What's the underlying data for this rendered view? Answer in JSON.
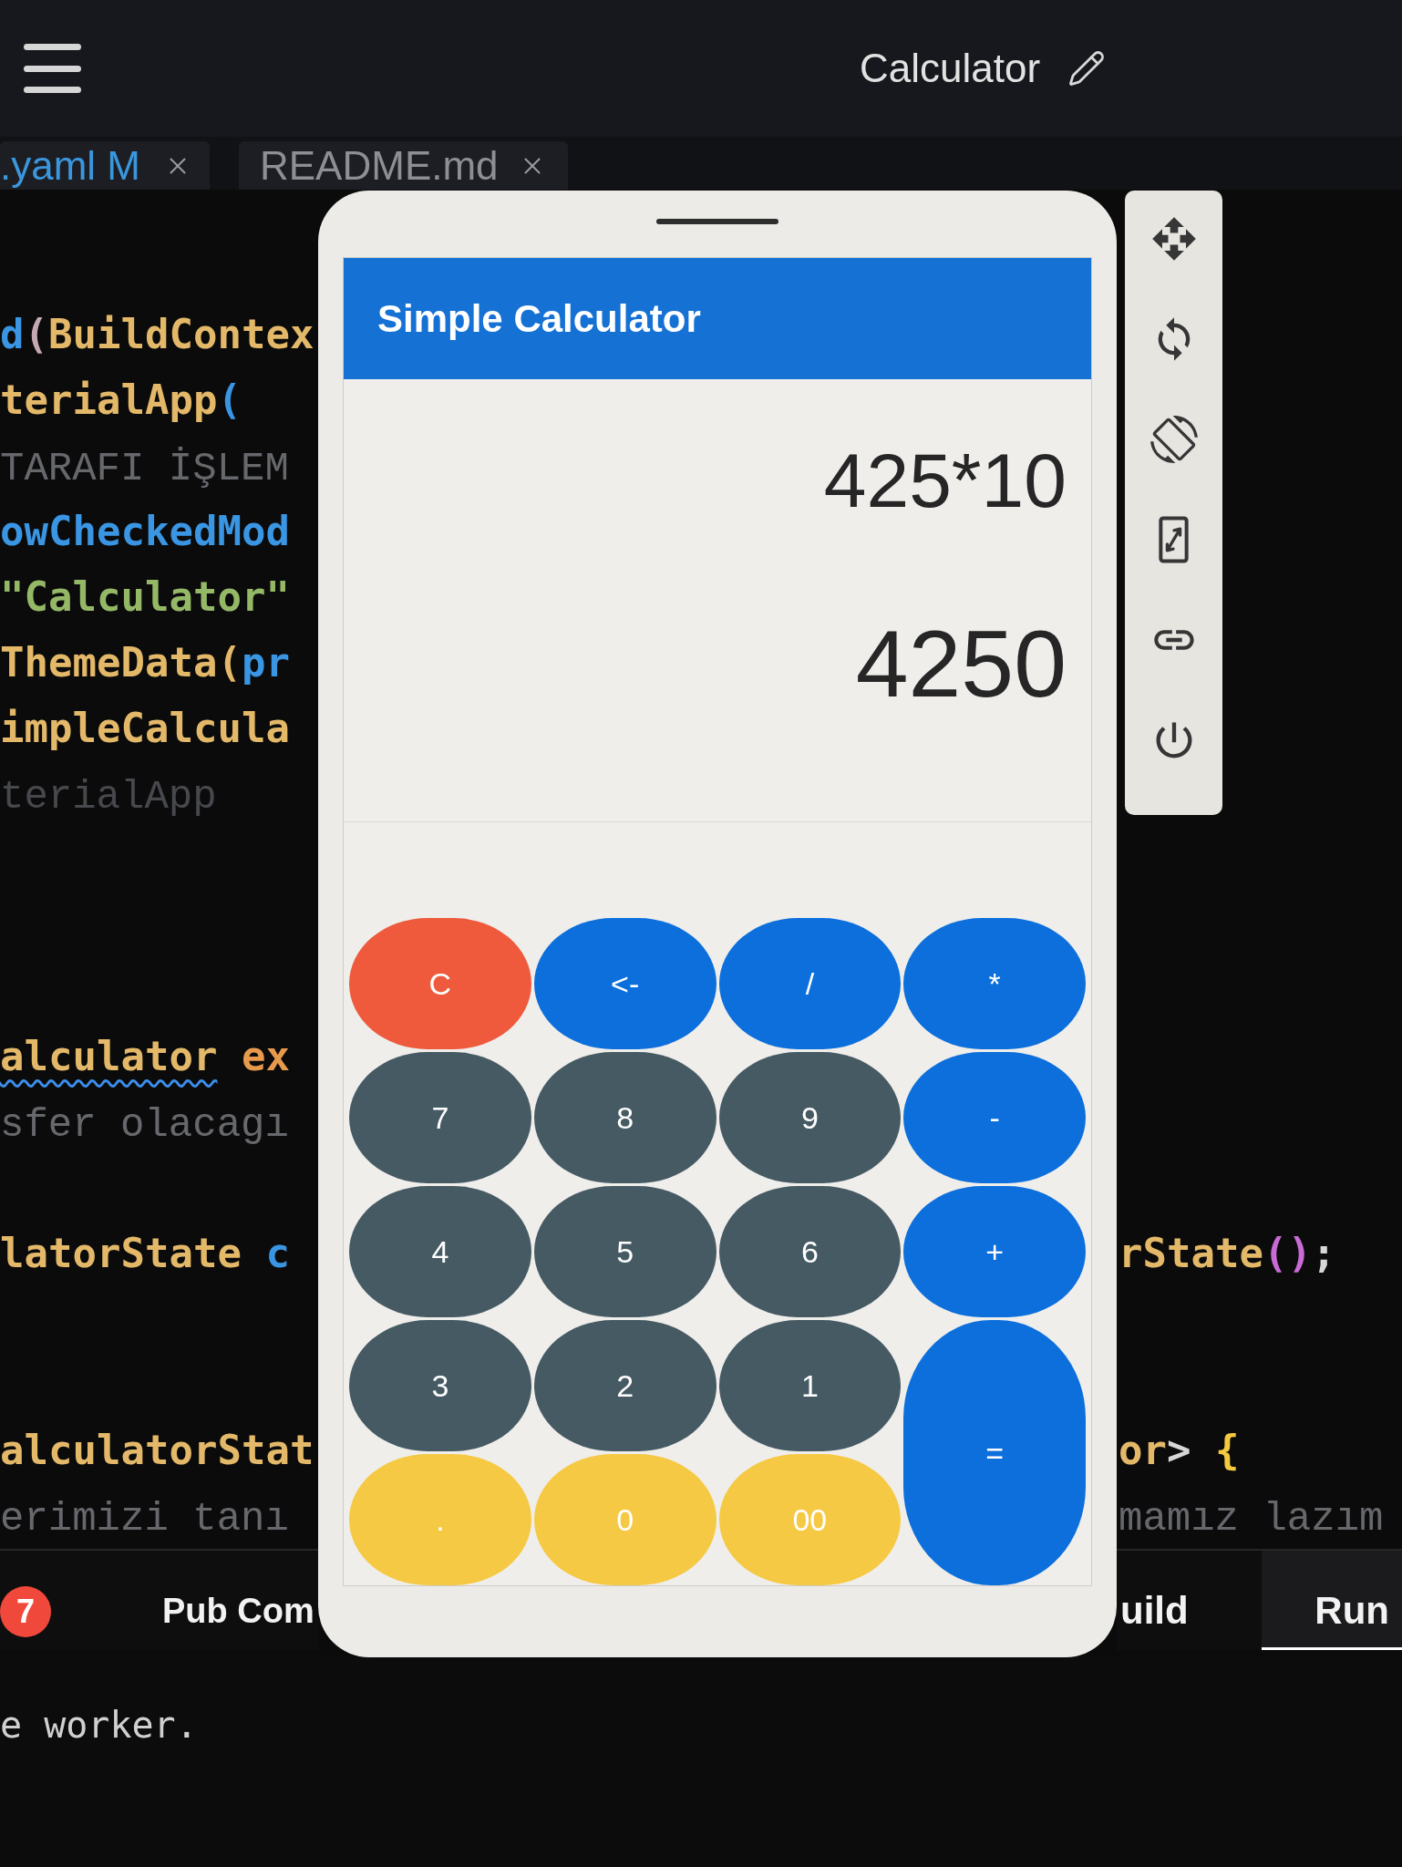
{
  "top_bar": {
    "title": "Calculator"
  },
  "editor_tabs": [
    {
      "label": ".yaml M",
      "modified": true
    },
    {
      "label": "README.md",
      "modified": false
    }
  ],
  "editor": {
    "lines": [
      {
        "kind": "code",
        "left": [
          {
            "text": "d",
            "kind": "keyword",
            "warning": false
          },
          {
            "text": "(",
            "kind": "operator",
            "warning": false
          },
          {
            "text": "BuildContex",
            "kind": "class",
            "warning": false
          }
        ]
      },
      {
        "kind": "code",
        "left": [
          {
            "text": "terialApp",
            "kind": "class",
            "warning": false
          },
          {
            "text": "(",
            "kind": "keyword",
            "warning": false
          }
        ]
      },
      {
        "kind": "code",
        "left": [
          {
            "text": "TARAFI İŞLEM",
            "kind": "comment",
            "warning": false
          }
        ]
      },
      {
        "kind": "code",
        "left": [
          {
            "text": "owCheckedMod",
            "kind": "keyword",
            "warning": false
          }
        ]
      },
      {
        "kind": "code",
        "left": [
          {
            "text": "\"Calculator\"",
            "kind": "string",
            "warning": false
          }
        ]
      },
      {
        "kind": "code",
        "left": [
          {
            "text": "ThemeData(",
            "kind": "class",
            "warning": false
          },
          {
            "text": "pr",
            "kind": "keyword",
            "warning": false
          }
        ]
      },
      {
        "kind": "code",
        "left": [
          {
            "text": "impleCalcula",
            "kind": "class",
            "warning": false
          }
        ]
      },
      {
        "kind": "code",
        "left": [
          {
            "text": "terialApp",
            "kind": "label",
            "warning": false
          }
        ]
      },
      {
        "kind": "blank"
      },
      {
        "kind": "blank"
      },
      {
        "kind": "blank"
      },
      {
        "kind": "code",
        "left": [
          {
            "text": "alculator",
            "kind": "class",
            "warning": true
          },
          {
            "text": " ex",
            "kind": "modifier",
            "warning": false
          }
        ]
      },
      {
        "kind": "code",
        "left": [
          {
            "text": "sfer olacagı",
            "kind": "comment",
            "warning": false
          }
        ]
      },
      {
        "kind": "blank"
      },
      {
        "kind": "code",
        "left": [
          {
            "text": "latorState",
            "kind": "class",
            "warning": false
          },
          {
            "text": " c",
            "kind": "keyword",
            "warning": false
          }
        ],
        "right": [
          {
            "text": "rState",
            "kind": "class",
            "warning": false
          },
          {
            "text": "()",
            "kind": "paren",
            "warning": false
          },
          {
            "text": ";",
            "kind": "plain",
            "warning": false
          }
        ]
      },
      {
        "kind": "blank"
      },
      {
        "kind": "blank"
      },
      {
        "kind": "code",
        "left": [
          {
            "text": "alculatorStat",
            "kind": "class",
            "warning": false
          }
        ],
        "right": [
          {
            "text": "or",
            "kind": "class",
            "warning": false
          },
          {
            "text": ">",
            "kind": "plain",
            "warning": false
          },
          {
            "text": " {",
            "kind": "brace",
            "warning": false
          }
        ]
      },
      {
        "kind": "code",
        "left": [
          {
            "text": "erimizi tanı",
            "kind": "comment",
            "warning": false
          }
        ],
        "right": [
          {
            "text": "mamız lazım",
            "kind": "comment",
            "warning": false
          }
        ]
      }
    ]
  },
  "emulator": {
    "app_title": "Simple Calculator",
    "expression": "425*10",
    "result": "4250",
    "keys": [
      {
        "label": "C",
        "kind": "clear"
      },
      {
        "label": "<-",
        "kind": "operator"
      },
      {
        "label": "/",
        "kind": "operator"
      },
      {
        "label": "*",
        "kind": "operator"
      },
      {
        "label": "7",
        "kind": "digit"
      },
      {
        "label": "8",
        "kind": "digit"
      },
      {
        "label": "9",
        "kind": "digit"
      },
      {
        "label": "-",
        "kind": "operator"
      },
      {
        "label": "4",
        "kind": "digit"
      },
      {
        "label": "5",
        "kind": "digit"
      },
      {
        "label": "6",
        "kind": "digit"
      },
      {
        "label": "+",
        "kind": "operator"
      },
      {
        "label": "3",
        "kind": "digit"
      },
      {
        "label": "2",
        "kind": "digit"
      },
      {
        "label": "1",
        "kind": "digit"
      },
      {
        "label": "=",
        "kind": "equals"
      },
      {
        "label": ".",
        "kind": "extra"
      },
      {
        "label": "0",
        "kind": "extra"
      },
      {
        "label": "00",
        "kind": "extra"
      }
    ]
  },
  "bottom_panel": {
    "badge": "7",
    "tabs_left": [
      {
        "label": "Pub Com",
        "selected": false
      }
    ],
    "tabs_right": [
      {
        "label": "uild",
        "selected": false
      },
      {
        "label": "Run",
        "selected": true
      }
    ],
    "output": [
      "e worker."
    ]
  }
}
